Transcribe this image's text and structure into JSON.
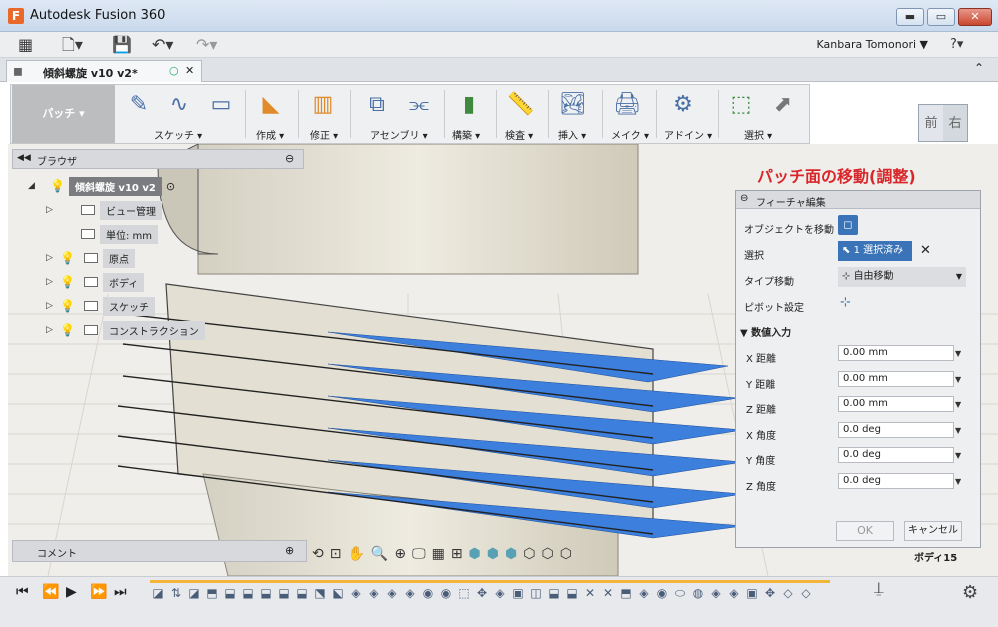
{
  "window": {
    "title": "Autodesk Fusion 360",
    "minimize": "▬",
    "maximize": "▭",
    "close": "✕"
  },
  "qat": {
    "user": "Kanbara Tomonori ▼",
    "help": "?▾"
  },
  "tab": {
    "label": "傾斜螺旋 v10 v2*"
  },
  "toolbar": {
    "patch": "パッチ ▾",
    "groups": [
      {
        "label": "スケッチ ▾"
      },
      {
        "label": "作成 ▾"
      },
      {
        "label": "修正 ▾"
      },
      {
        "label": "アセンブリ ▾"
      },
      {
        "label": "構築 ▾"
      },
      {
        "label": "検査 ▾"
      },
      {
        "label": "挿入 ▾"
      },
      {
        "label": "メイク ▾"
      },
      {
        "label": "アドイン ▾"
      },
      {
        "label": "選択 ▾"
      }
    ]
  },
  "viewcube": {
    "front": "前",
    "right": "右"
  },
  "browser": {
    "title": "ブラウザ",
    "root": "傾斜螺旋 v10 v2",
    "items": [
      {
        "label": "ビュー管理"
      },
      {
        "label": "単位: mm"
      },
      {
        "label": "原点"
      },
      {
        "label": "ボディ"
      },
      {
        "label": "スケッチ"
      },
      {
        "label": "コンストラクション"
      }
    ]
  },
  "annotation": "パッチ面の移動(調整)",
  "dialog": {
    "title": "フィーチャ編集",
    "move_object_label": "オブジェクトを移動",
    "select_label": "選択",
    "select_value": "1 選択済み",
    "move_type_label": "タイプ移動",
    "move_type_value": "自由移動",
    "pivot_label": "ピボット設定",
    "numeric_section": "▼ 数値入力",
    "fields": [
      {
        "label": "X 距離",
        "value": "0.00 mm"
      },
      {
        "label": "Y 距離",
        "value": "0.00 mm"
      },
      {
        "label": "Z 距離",
        "value": "0.00 mm"
      },
      {
        "label": "X 角度",
        "value": "0.0 deg"
      },
      {
        "label": "Y 角度",
        "value": "0.0 deg"
      },
      {
        "label": "Z 角度",
        "value": "0.0 deg"
      }
    ],
    "ok": "OK",
    "cancel": "キャンセル"
  },
  "status": {
    "body_label": "ボディ15"
  },
  "comment": {
    "label": "コメント"
  }
}
